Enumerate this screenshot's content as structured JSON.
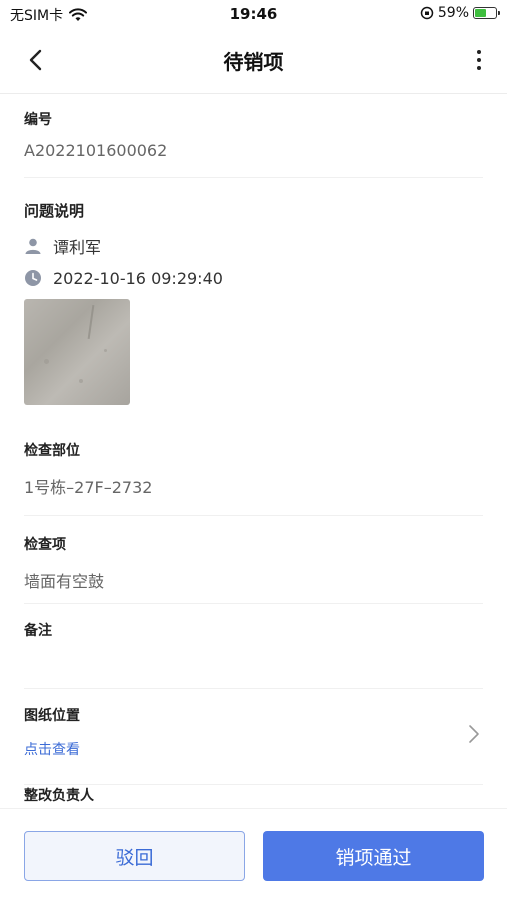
{
  "status_bar": {
    "carrier": "无SIM卡",
    "time": "19:46",
    "battery_percent": "59%",
    "battery_level": 0.59
  },
  "nav": {
    "title": "待销项"
  },
  "fields": {
    "id_label": "编号",
    "id_value": "A2022101600062",
    "issue_label": "问题说明",
    "reporter": "谭利军",
    "timestamp": "2022-10-16 09:29:40",
    "location_label": "检查部位",
    "location_value": "1号栋–27F–2732",
    "item_label": "检查项",
    "item_value": "墙面有空鼓",
    "remark_label": "备注",
    "drawing_label": "图纸位置",
    "drawing_link": "点击查看",
    "owner_label": "整改负责人"
  },
  "actions": {
    "reject_label": "驳回",
    "pass_label": "销项通过"
  },
  "colors": {
    "accent": "#4e79e6",
    "link": "#3b6bd6"
  }
}
